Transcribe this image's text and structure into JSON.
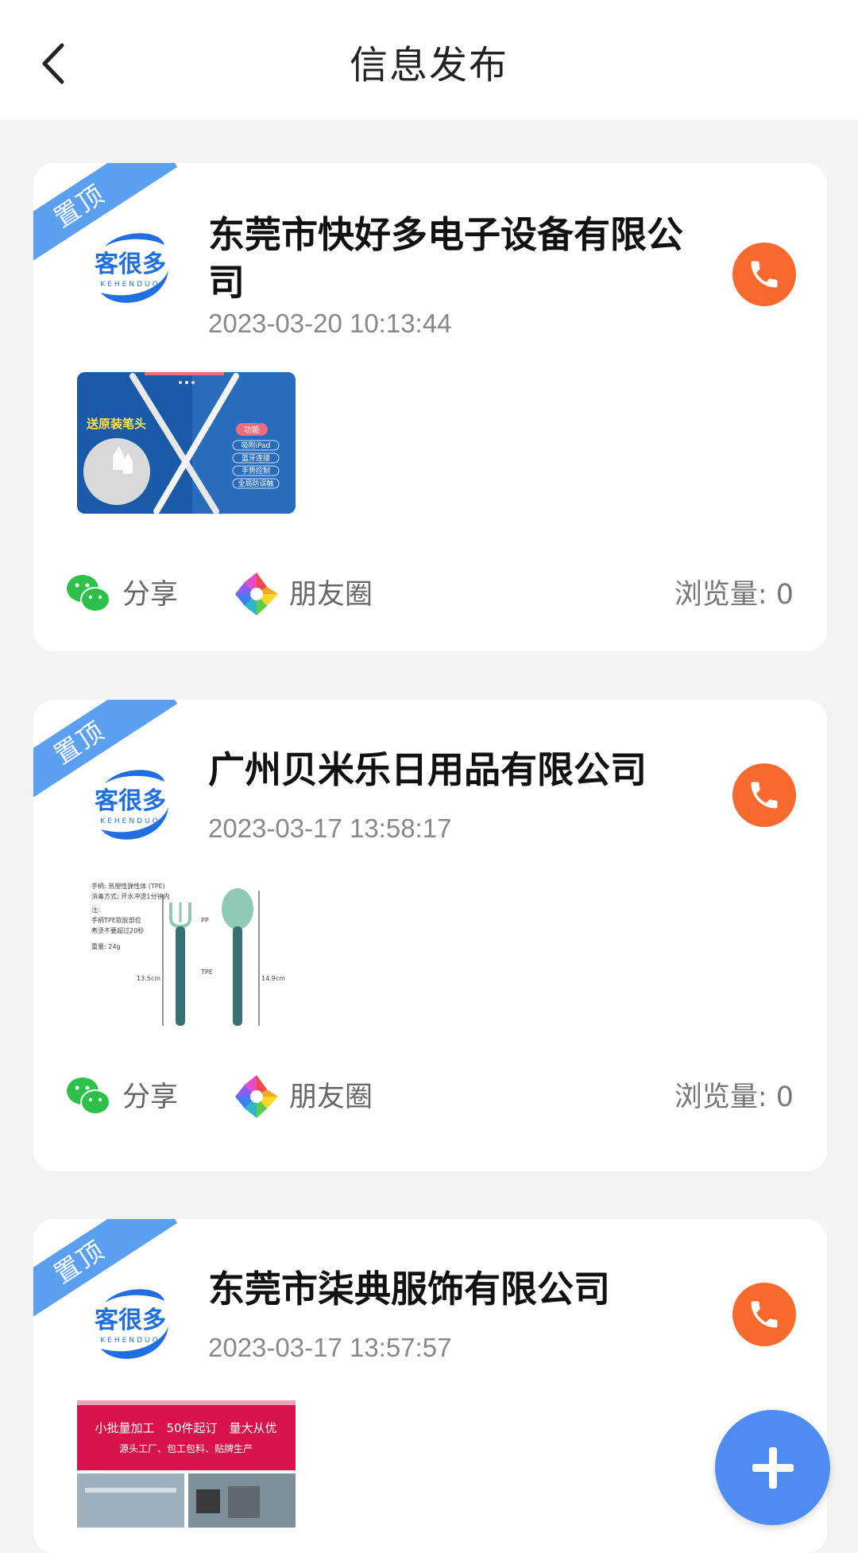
{
  "header": {
    "title": "信息发布"
  },
  "posts": [
    {
      "badge": "置顶",
      "logo_text": "客很多",
      "logo_sub": "KEHENDUO",
      "company": "东莞市快好多电子设备有限公司",
      "date": "2023-03-20 10:13:44",
      "thumb": {
        "line1": "送原装笔头",
        "tag": "功能",
        "f1": "吸附iPad",
        "f2": "蓝牙连接",
        "f3": "手势控制",
        "f4": "全局防误触"
      },
      "share_label": "分享",
      "moments_label": "朋友圈",
      "views_label": "浏览量: 0"
    },
    {
      "badge": "置顶",
      "logo_text": "客很多",
      "logo_sub": "KEHENDUO",
      "company": "广州贝米乐日用品有限公司",
      "date": "2023-03-17 13:58:17",
      "thumb": {
        "l1": "手柄: 热塑性弹性体 (TPE)",
        "l2": "消毒方式: 开水冲烫1分钟内",
        "l3": "注:",
        "l4": "手柄TPE软胶部位",
        "l5": "煮烫不要超过20秒",
        "l6": "重量: 24g",
        "pp": "PP",
        "tpe": "TPE",
        "w1": "13.5cm",
        "w2": "14.9cm"
      },
      "share_label": "分享",
      "moments_label": "朋友圈",
      "views_label": "浏览量: 0"
    },
    {
      "badge": "置顶",
      "logo_text": "客很多",
      "logo_sub": "KEHENDUO",
      "company": "东莞市柒典服饰有限公司",
      "date": "2023-03-17 13:57:57",
      "thumb": {
        "line1": "小批量加工　50件起订　量大从优",
        "line2": "源头工厂、包工包料、贴牌生产"
      }
    }
  ],
  "colors": {
    "accent": "#4f8cf2",
    "phone": "#f76a2e",
    "badge": "#5a9ff0"
  }
}
